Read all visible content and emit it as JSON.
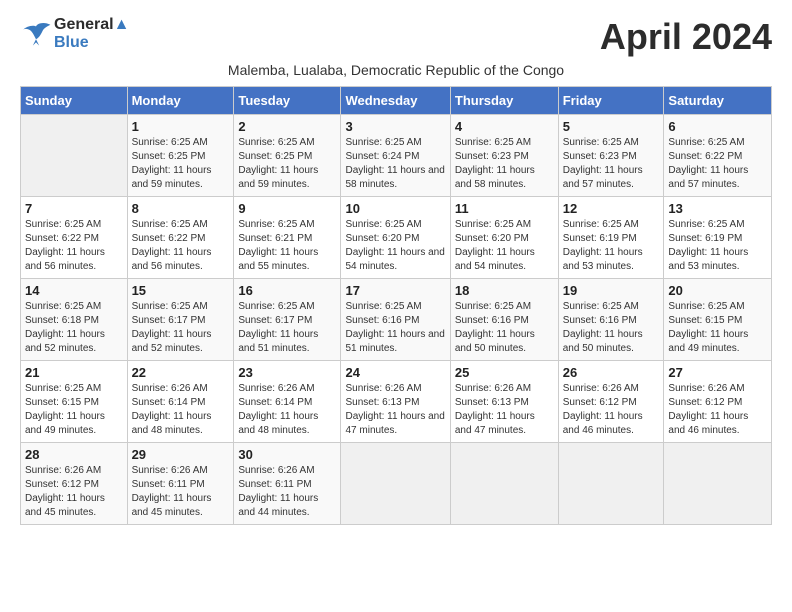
{
  "header": {
    "logo_line1": "General",
    "logo_line2": "Blue",
    "month_title": "April 2024",
    "subtitle": "Malemba, Lualaba, Democratic Republic of the Congo"
  },
  "days_of_week": [
    "Sunday",
    "Monday",
    "Tuesday",
    "Wednesday",
    "Thursday",
    "Friday",
    "Saturday"
  ],
  "weeks": [
    [
      {
        "day": "",
        "empty": true
      },
      {
        "day": "1",
        "sunrise": "6:25 AM",
        "sunset": "6:25 PM",
        "daylight": "11 hours and 59 minutes."
      },
      {
        "day": "2",
        "sunrise": "6:25 AM",
        "sunset": "6:25 PM",
        "daylight": "11 hours and 59 minutes."
      },
      {
        "day": "3",
        "sunrise": "6:25 AM",
        "sunset": "6:24 PM",
        "daylight": "11 hours and 58 minutes."
      },
      {
        "day": "4",
        "sunrise": "6:25 AM",
        "sunset": "6:23 PM",
        "daylight": "11 hours and 58 minutes."
      },
      {
        "day": "5",
        "sunrise": "6:25 AM",
        "sunset": "6:23 PM",
        "daylight": "11 hours and 57 minutes."
      },
      {
        "day": "6",
        "sunrise": "6:25 AM",
        "sunset": "6:22 PM",
        "daylight": "11 hours and 57 minutes."
      }
    ],
    [
      {
        "day": "7",
        "sunrise": "6:25 AM",
        "sunset": "6:22 PM",
        "daylight": "11 hours and 56 minutes."
      },
      {
        "day": "8",
        "sunrise": "6:25 AM",
        "sunset": "6:22 PM",
        "daylight": "11 hours and 56 minutes."
      },
      {
        "day": "9",
        "sunrise": "6:25 AM",
        "sunset": "6:21 PM",
        "daylight": "11 hours and 55 minutes."
      },
      {
        "day": "10",
        "sunrise": "6:25 AM",
        "sunset": "6:20 PM",
        "daylight": "11 hours and 54 minutes."
      },
      {
        "day": "11",
        "sunrise": "6:25 AM",
        "sunset": "6:20 PM",
        "daylight": "11 hours and 54 minutes."
      },
      {
        "day": "12",
        "sunrise": "6:25 AM",
        "sunset": "6:19 PM",
        "daylight": "11 hours and 53 minutes."
      },
      {
        "day": "13",
        "sunrise": "6:25 AM",
        "sunset": "6:19 PM",
        "daylight": "11 hours and 53 minutes."
      }
    ],
    [
      {
        "day": "14",
        "sunrise": "6:25 AM",
        "sunset": "6:18 PM",
        "daylight": "11 hours and 52 minutes."
      },
      {
        "day": "15",
        "sunrise": "6:25 AM",
        "sunset": "6:17 PM",
        "daylight": "11 hours and 52 minutes."
      },
      {
        "day": "16",
        "sunrise": "6:25 AM",
        "sunset": "6:17 PM",
        "daylight": "11 hours and 51 minutes."
      },
      {
        "day": "17",
        "sunrise": "6:25 AM",
        "sunset": "6:16 PM",
        "daylight": "11 hours and 51 minutes."
      },
      {
        "day": "18",
        "sunrise": "6:25 AM",
        "sunset": "6:16 PM",
        "daylight": "11 hours and 50 minutes."
      },
      {
        "day": "19",
        "sunrise": "6:25 AM",
        "sunset": "6:16 PM",
        "daylight": "11 hours and 50 minutes."
      },
      {
        "day": "20",
        "sunrise": "6:25 AM",
        "sunset": "6:15 PM",
        "daylight": "11 hours and 49 minutes."
      }
    ],
    [
      {
        "day": "21",
        "sunrise": "6:25 AM",
        "sunset": "6:15 PM",
        "daylight": "11 hours and 49 minutes."
      },
      {
        "day": "22",
        "sunrise": "6:26 AM",
        "sunset": "6:14 PM",
        "daylight": "11 hours and 48 minutes."
      },
      {
        "day": "23",
        "sunrise": "6:26 AM",
        "sunset": "6:14 PM",
        "daylight": "11 hours and 48 minutes."
      },
      {
        "day": "24",
        "sunrise": "6:26 AM",
        "sunset": "6:13 PM",
        "daylight": "11 hours and 47 minutes."
      },
      {
        "day": "25",
        "sunrise": "6:26 AM",
        "sunset": "6:13 PM",
        "daylight": "11 hours and 47 minutes."
      },
      {
        "day": "26",
        "sunrise": "6:26 AM",
        "sunset": "6:12 PM",
        "daylight": "11 hours and 46 minutes."
      },
      {
        "day": "27",
        "sunrise": "6:26 AM",
        "sunset": "6:12 PM",
        "daylight": "11 hours and 46 minutes."
      }
    ],
    [
      {
        "day": "28",
        "sunrise": "6:26 AM",
        "sunset": "6:12 PM",
        "daylight": "11 hours and 45 minutes."
      },
      {
        "day": "29",
        "sunrise": "6:26 AM",
        "sunset": "6:11 PM",
        "daylight": "11 hours and 45 minutes."
      },
      {
        "day": "30",
        "sunrise": "6:26 AM",
        "sunset": "6:11 PM",
        "daylight": "11 hours and 44 minutes."
      },
      {
        "day": "",
        "empty": true
      },
      {
        "day": "",
        "empty": true
      },
      {
        "day": "",
        "empty": true
      },
      {
        "day": "",
        "empty": true
      }
    ]
  ]
}
